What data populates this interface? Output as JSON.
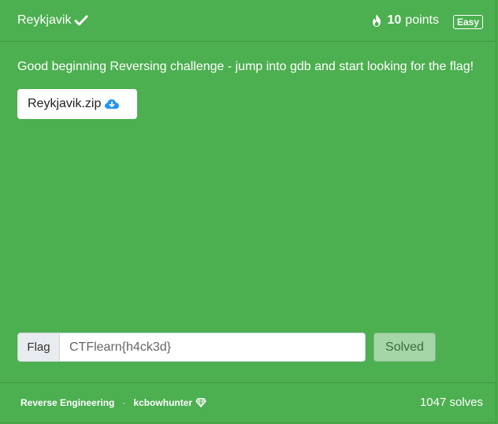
{
  "challenge": {
    "title": "Reykjavik",
    "points_value": "10",
    "points_label": "points",
    "difficulty": "Easy",
    "description": "Good beginning Reversing challenge - jump into gdb and start looking for the flag!",
    "file_name": "Reykjavik.zip"
  },
  "flag_form": {
    "label": "Flag",
    "value": "CTFlearn{h4ck3d}",
    "submit_label": "Solved"
  },
  "footer": {
    "category": "Reverse Engineering",
    "separator": "·",
    "author": "kcbowhunter",
    "solves": "1047 solves"
  },
  "colors": {
    "card_bg": "#4caf50",
    "solved_button": "#a5d6a7",
    "download_icon": "#2196f3"
  }
}
